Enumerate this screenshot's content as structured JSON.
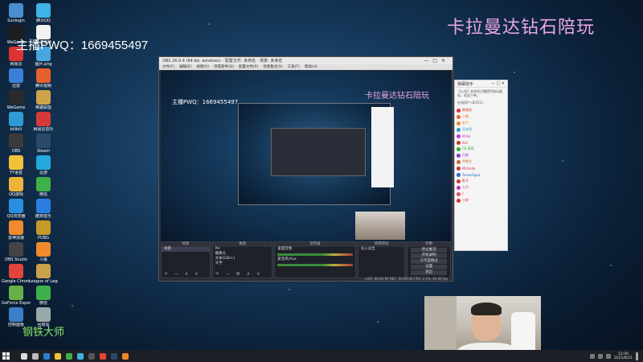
{
  "overlay": {
    "title": "卡拉曼达钻石陪玩",
    "host_qq": "主播PWQ：1669455497",
    "corner_text": "钢铁大师"
  },
  "desktop_icons": [
    {
      "label": "Sunlogin",
      "color": "#4a8ed0"
    },
    {
      "label": "腾讯QQ",
      "color": "#3fb2e6"
    },
    {
      "label": "WeGame",
      "color": "#1d1d1d"
    },
    {
      "label": "新建文档",
      "color": "#f2f2f2"
    },
    {
      "label": "网易云",
      "color": "#d33"
    },
    {
      "label": "图片.png",
      "color": "#48a7e0"
    },
    {
      "label": "迅雷",
      "color": "#3b80d6"
    },
    {
      "label": "腾讯视频",
      "color": "#e7612f"
    },
    {
      "label": "WeGame",
      "color": "#2a2a2a"
    },
    {
      "label": "英雄联盟",
      "color": "#cda44a"
    },
    {
      "label": "bilibili",
      "color": "#2f9ad4"
    },
    {
      "label": "网易云音乐",
      "color": "#d43a3a"
    },
    {
      "label": "OBS",
      "color": "#3a3a3a"
    },
    {
      "label": "Steam",
      "color": "#2b4a6a"
    },
    {
      "label": "YY语音",
      "color": "#f0c23a"
    },
    {
      "label": "迅游",
      "color": "#25a8dd"
    },
    {
      "label": "QQ游戏",
      "color": "#eeb33a"
    },
    {
      "label": "微信",
      "color": "#3fb14a"
    },
    {
      "label": "QQ浏览器",
      "color": "#2a8fe0"
    },
    {
      "label": "酷狗音乐",
      "color": "#2a7ee0"
    },
    {
      "label": "雷神加速",
      "color": "#ef8b2c"
    },
    {
      "label": "PUBG",
      "color": "#c59a2a"
    },
    {
      "label": "OBS Studio",
      "color": "#444"
    },
    {
      "label": "斗鱼",
      "color": "#f08a2a"
    },
    {
      "label": "Google Chrome",
      "color": "#e3443a"
    },
    {
      "label": "League of Legends",
      "color": "#c8a24a"
    },
    {
      "label": "GeForce Experience",
      "color": "#6ab04a"
    },
    {
      "label": "微信",
      "color": "#3fb14a"
    },
    {
      "label": "控制面板",
      "color": "#3a7ec8"
    },
    {
      "label": "回收站",
      "color": "#9aa"
    }
  ],
  "obs": {
    "title": "OBS 26.0.4 (64-bit, windows) - 配置文件: 未命名 - 场景: 未命名",
    "controls": "—□✕",
    "menus": [
      "文件(F)",
      "编辑(E)",
      "视图(V)",
      "停靠部件(D)",
      "配置文件(P)",
      "场景集合(S)",
      "工具(T)",
      "帮助(H)"
    ],
    "preview_title": "卡拉曼达钻石陪玩",
    "preview_qq": "主播PWQ：1669455497",
    "docks": {
      "scenes": {
        "header": "场景",
        "items": [
          "场景"
        ],
        "footer": "+ − ∧ ∨"
      },
      "sources": {
        "header": "来源",
        "items": [
          "Pic",
          "摄像头",
          "文本(GDI+)",
          "文字",
          "文字",
          "图像"
        ],
        "footer": "+ − ⚙ ∧ ∨"
      },
      "mixer": {
        "header": "混音器",
        "items": [
          "桌面音频",
          "麦克风/Aux"
        ]
      },
      "transitions": {
        "header": "场景转场",
        "items": [
          "淡入淡出"
        ]
      },
      "controls": {
        "header": "控制",
        "items": [
          "停止推流",
          "开始录制",
          "工作室模式",
          "设置",
          "退出"
        ]
      }
    },
    "status": "LIVE: 00:00:00  REC: 00:00:00  CPU: 2.1%, 60.00 fps"
  },
  "chat": {
    "header_title": "弹幕助手",
    "header_controls": "— □ ✕",
    "notice": "【公告】本房间主播提供陪玩服务，欢迎下单。",
    "online_label": "在线用户 (8/251)",
    "users": [
      {
        "name": "钢铁侠",
        "color": "#d33"
      },
      {
        "name": "小莫",
        "color": "#e63"
      },
      {
        "name": "老子",
        "color": "#e83"
      },
      {
        "name": "坦克哥",
        "color": "#39c"
      },
      {
        "name": "Miller",
        "color": "#c3c"
      },
      {
        "name": "Ikki",
        "color": "#c33"
      },
      {
        "name": "CE·周哥",
        "color": "#3a3"
      },
      {
        "name": "白狼",
        "color": "#93c"
      },
      {
        "name": "甲骨文",
        "color": "#c63"
      },
      {
        "name": "Michelle",
        "color": "#c33"
      },
      {
        "name": "TuzueOgua",
        "color": "#36c"
      },
      {
        "name": "影子",
        "color": "#c33"
      },
      {
        "name": "九月",
        "color": "#c3a"
      },
      {
        "name": "F",
        "color": "#d55"
      },
      {
        "name": "小虎",
        "color": "#c33"
      }
    ]
  },
  "taskbar": {
    "start_icon": "windows-logo-icon",
    "apps": [
      {
        "name": "search-icon",
        "color": "#ddd"
      },
      {
        "name": "task-view-icon",
        "color": "#bbb"
      },
      {
        "name": "edge-icon",
        "color": "#2a7fd4"
      },
      {
        "name": "explorer-icon",
        "color": "#f0c23a"
      },
      {
        "name": "wechat-icon",
        "color": "#3fb14a"
      },
      {
        "name": "qq-icon",
        "color": "#3fb2e6"
      },
      {
        "name": "obs-icon",
        "color": "#555"
      },
      {
        "name": "chrome-icon",
        "color": "#e3443a"
      },
      {
        "name": "steam-icon",
        "color": "#2b4a6a"
      },
      {
        "name": "douyu-icon",
        "color": "#f08a2a"
      }
    ],
    "clock_time": "12:00",
    "clock_date": "2021/8/21"
  }
}
